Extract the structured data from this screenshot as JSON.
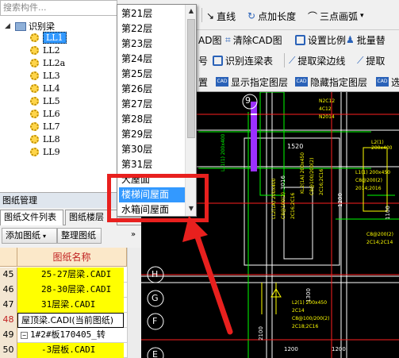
{
  "search": {
    "placeholder": "搜索构件..."
  },
  "tree": {
    "root": "识别梁",
    "items": [
      "LL1",
      "LL2",
      "LL2a",
      "LL3",
      "LL4",
      "LL5",
      "LL6",
      "LL7",
      "LL8",
      "LL9"
    ],
    "selected": "LL1"
  },
  "drawing_panel": {
    "title": "图纸管理",
    "tabs": [
      "图纸文件列表",
      "图纸楼层"
    ],
    "add_button": "添加图纸",
    "organize_button": "整理图纸",
    "expand_icon": "»",
    "column_header": "图纸名称",
    "rows": [
      {
        "num": "45",
        "name": "25-27层梁.CADI",
        "style": "yellow"
      },
      {
        "num": "46",
        "name": "28-30层梁.CADI",
        "style": "yellow"
      },
      {
        "num": "47",
        "name": "31层梁.CADI",
        "style": "yellow"
      },
      {
        "num": "48",
        "name": "屋顶梁.CADI(当前图纸)",
        "style": "current"
      },
      {
        "num": "49",
        "name": "1#2#板170405_转",
        "style": "white"
      },
      {
        "num": "50",
        "name": "-3层板.CADI",
        "style": "yellow"
      }
    ]
  },
  "toolbar": {
    "line": "直线",
    "point_length": "点加长度",
    "three_point_arc": "三点画弧",
    "cad_map": "AD图",
    "clear_cad": "清除CAD图",
    "set_scale": "设置比例",
    "batch_replace": "批量替",
    "num_suffix": "号",
    "identify_continuous_beam": "识别连梁表",
    "extract_beam_edge": "提取梁边线",
    "extract_short": "提取",
    "set_short": "置",
    "show_layer": "显示指定图层",
    "hide_layer": "隐藏指定图层",
    "trailing": "选"
  },
  "floor_dropdown": {
    "items": [
      "第21层",
      "第22层",
      "第23层",
      "第24层",
      "第25层",
      "第26层",
      "第27层",
      "第28层",
      "第29层",
      "第30层",
      "第31层",
      "大屋面",
      "楼梯间屋面",
      "水箱间屋面"
    ],
    "selected": "楼梯间屋面"
  },
  "cad": {
    "axis_labels": [
      "9",
      "H",
      "G",
      "F",
      "E"
    ],
    "dims": [
      "1520",
      "3016",
      "1200",
      "1100",
      "1300",
      "2100",
      "1200",
      "1200"
    ],
    "beam_notes": [
      "KL2(1A) 200x450",
      "C8@100/200(2)",
      "2C16;2C16",
      "L2(1) 200x400",
      "C8@200(2)",
      "2C14;2C14",
      "LL1(1) 200x400",
      "LL2(1A) 200x400",
      "C8@100(2)",
      "2C16;2C16",
      "L1(1) 200x450",
      "C8@200(2)",
      "2014;2016",
      "L2(1) 200x450",
      "2C14",
      "C8@100/200(2)",
      "2C18;2C16",
      "N2C12",
      "4C12",
      "N2014"
    ]
  },
  "colors": {
    "cad_bg": "#000000",
    "accent_red": "#e8201e",
    "selection_blue": "#3399ff"
  }
}
